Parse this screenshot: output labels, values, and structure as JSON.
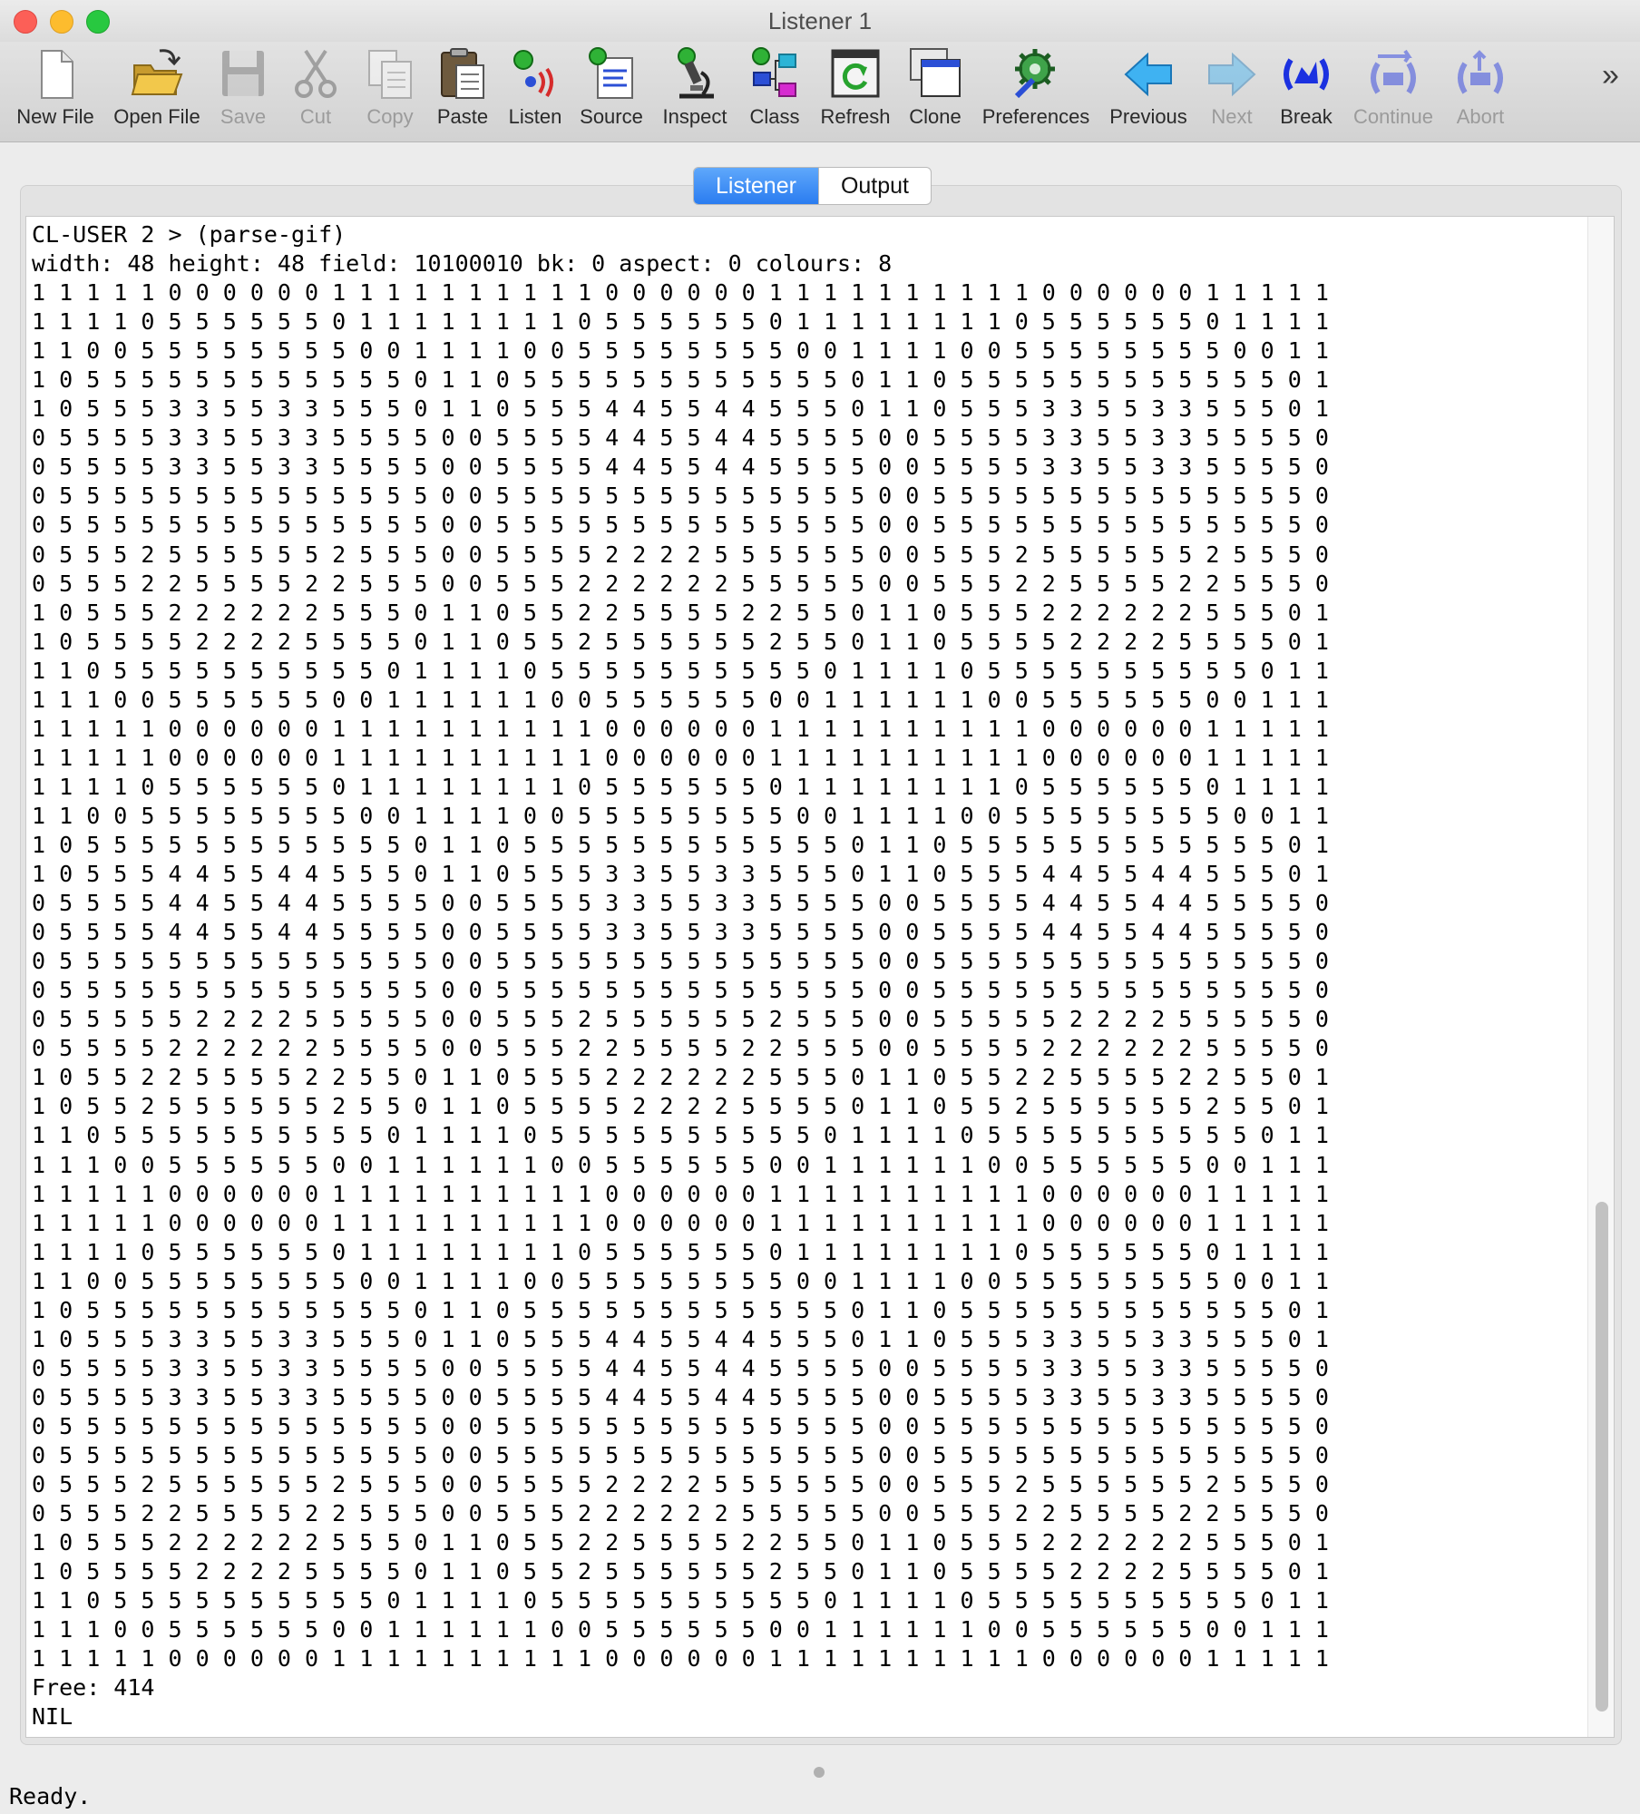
{
  "window": {
    "title": "Listener 1"
  },
  "toolbar": {
    "new_file": "New File",
    "open_file": "Open File",
    "save": "Save",
    "cut": "Cut",
    "copy": "Copy",
    "paste": "Paste",
    "listen": "Listen",
    "source": "Source",
    "inspect": "Inspect",
    "class": "Class",
    "refresh": "Refresh",
    "clone": "Clone",
    "preferences": "Preferences",
    "previous": "Previous",
    "next": "Next",
    "break": "Break",
    "continue": "Continue",
    "abort": "Abort",
    "overflow": "»"
  },
  "tabs": {
    "listener": "Listener",
    "output": "Output",
    "active": "Listener"
  },
  "listener": {
    "prompt": "CL-USER 2 > (parse-gif)",
    "info": "width: 48 height: 48 field: 10100010 bk: 0 aspect: 0 colours: 8",
    "rows": [
      "1 1 1 1 1 0 0 0 0 0 0 1 1 1 1 1 1 1 1 1 1 0 0 0 0 0 0 1 1 1 1 1 1 1 1 1 1 0 0 0 0 0 0 1 1 1 1 1",
      "1 1 1 1 0 5 5 5 5 5 5 0 1 1 1 1 1 1 1 1 0 5 5 5 5 5 5 0 1 1 1 1 1 1 1 1 0 5 5 5 5 5 5 0 1 1 1 1",
      "1 1 0 0 5 5 5 5 5 5 5 5 0 0 1 1 1 1 0 0 5 5 5 5 5 5 5 5 0 0 1 1 1 1 0 0 5 5 5 5 5 5 5 5 0 0 1 1",
      "1 0 5 5 5 5 5 5 5 5 5 5 5 5 0 1 1 0 5 5 5 5 5 5 5 5 5 5 5 5 0 1 1 0 5 5 5 5 5 5 5 5 5 5 5 5 0 1",
      "1 0 5 5 5 3 3 5 5 3 3 5 5 5 0 1 1 0 5 5 5 4 4 5 5 4 4 5 5 5 0 1 1 0 5 5 5 3 3 5 5 3 3 5 5 5 0 1",
      "0 5 5 5 5 3 3 5 5 3 3 5 5 5 5 0 0 5 5 5 5 4 4 5 5 4 4 5 5 5 5 0 0 5 5 5 5 3 3 5 5 3 3 5 5 5 5 0",
      "0 5 5 5 5 3 3 5 5 3 3 5 5 5 5 0 0 5 5 5 5 4 4 5 5 4 4 5 5 5 5 0 0 5 5 5 5 3 3 5 5 3 3 5 5 5 5 0",
      "0 5 5 5 5 5 5 5 5 5 5 5 5 5 5 0 0 5 5 5 5 5 5 5 5 5 5 5 5 5 5 0 0 5 5 5 5 5 5 5 5 5 5 5 5 5 5 0",
      "0 5 5 5 5 5 5 5 5 5 5 5 5 5 5 0 0 5 5 5 5 5 5 5 5 5 5 5 5 5 5 0 0 5 5 5 5 5 5 5 5 5 5 5 5 5 5 0",
      "0 5 5 5 2 5 5 5 5 5 5 2 5 5 5 0 0 5 5 5 5 2 2 2 2 5 5 5 5 5 5 0 0 5 5 5 2 5 5 5 5 5 5 2 5 5 5 0",
      "0 5 5 5 2 2 5 5 5 5 2 2 5 5 5 0 0 5 5 5 2 2 2 2 2 2 5 5 5 5 5 0 0 5 5 5 2 2 5 5 5 5 2 2 5 5 5 0",
      "1 0 5 5 5 2 2 2 2 2 2 5 5 5 0 1 1 0 5 5 2 2 5 5 5 5 2 2 5 5 0 1 1 0 5 5 5 2 2 2 2 2 2 5 5 5 0 1",
      "1 0 5 5 5 5 2 2 2 2 5 5 5 5 0 1 1 0 5 5 2 5 5 5 5 5 5 2 5 5 0 1 1 0 5 5 5 5 2 2 2 2 5 5 5 5 0 1",
      "1 1 0 5 5 5 5 5 5 5 5 5 5 0 1 1 1 1 0 5 5 5 5 5 5 5 5 5 5 0 1 1 1 1 0 5 5 5 5 5 5 5 5 5 5 0 1 1",
      "1 1 1 0 0 5 5 5 5 5 5 0 0 1 1 1 1 1 1 0 0 5 5 5 5 5 5 0 0 1 1 1 1 1 1 0 0 5 5 5 5 5 5 0 0 1 1 1",
      "1 1 1 1 1 0 0 0 0 0 0 1 1 1 1 1 1 1 1 1 1 0 0 0 0 0 0 1 1 1 1 1 1 1 1 1 1 0 0 0 0 0 0 1 1 1 1 1",
      "1 1 1 1 1 0 0 0 0 0 0 1 1 1 1 1 1 1 1 1 1 0 0 0 0 0 0 1 1 1 1 1 1 1 1 1 1 0 0 0 0 0 0 1 1 1 1 1",
      "1 1 1 1 0 5 5 5 5 5 5 0 1 1 1 1 1 1 1 1 0 5 5 5 5 5 5 0 1 1 1 1 1 1 1 1 0 5 5 5 5 5 5 0 1 1 1 1",
      "1 1 0 0 5 5 5 5 5 5 5 5 0 0 1 1 1 1 0 0 5 5 5 5 5 5 5 5 0 0 1 1 1 1 0 0 5 5 5 5 5 5 5 5 0 0 1 1",
      "1 0 5 5 5 5 5 5 5 5 5 5 5 5 0 1 1 0 5 5 5 5 5 5 5 5 5 5 5 5 0 1 1 0 5 5 5 5 5 5 5 5 5 5 5 5 0 1",
      "1 0 5 5 5 4 4 5 5 4 4 5 5 5 0 1 1 0 5 5 5 3 3 5 5 3 3 5 5 5 0 1 1 0 5 5 5 4 4 5 5 4 4 5 5 5 0 1",
      "0 5 5 5 5 4 4 5 5 4 4 5 5 5 5 0 0 5 5 5 5 3 3 5 5 3 3 5 5 5 5 0 0 5 5 5 5 4 4 5 5 4 4 5 5 5 5 0",
      "0 5 5 5 5 4 4 5 5 4 4 5 5 5 5 0 0 5 5 5 5 3 3 5 5 3 3 5 5 5 5 0 0 5 5 5 5 4 4 5 5 4 4 5 5 5 5 0",
      "0 5 5 5 5 5 5 5 5 5 5 5 5 5 5 0 0 5 5 5 5 5 5 5 5 5 5 5 5 5 5 0 0 5 5 5 5 5 5 5 5 5 5 5 5 5 5 0",
      "0 5 5 5 5 5 5 5 5 5 5 5 5 5 5 0 0 5 5 5 5 5 5 5 5 5 5 5 5 5 5 0 0 5 5 5 5 5 5 5 5 5 5 5 5 5 5 0",
      "0 5 5 5 5 5 2 2 2 2 5 5 5 5 5 0 0 5 5 5 2 5 5 5 5 5 5 2 5 5 5 0 0 5 5 5 5 5 2 2 2 2 5 5 5 5 5 0",
      "0 5 5 5 5 2 2 2 2 2 2 5 5 5 5 0 0 5 5 5 2 2 5 5 5 5 2 2 5 5 5 0 0 5 5 5 5 2 2 2 2 2 2 5 5 5 5 0",
      "1 0 5 5 2 2 5 5 5 5 2 2 5 5 0 1 1 0 5 5 5 2 2 2 2 2 2 5 5 5 0 1 1 0 5 5 2 2 5 5 5 5 2 2 5 5 0 1",
      "1 0 5 5 2 5 5 5 5 5 5 2 5 5 0 1 1 0 5 5 5 5 2 2 2 2 5 5 5 5 0 1 1 0 5 5 2 5 5 5 5 5 5 2 5 5 0 1",
      "1 1 0 5 5 5 5 5 5 5 5 5 5 0 1 1 1 1 0 5 5 5 5 5 5 5 5 5 5 0 1 1 1 1 0 5 5 5 5 5 5 5 5 5 5 0 1 1",
      "1 1 1 0 0 5 5 5 5 5 5 0 0 1 1 1 1 1 1 0 0 5 5 5 5 5 5 0 0 1 1 1 1 1 1 0 0 5 5 5 5 5 5 0 0 1 1 1",
      "1 1 1 1 1 0 0 0 0 0 0 1 1 1 1 1 1 1 1 1 1 0 0 0 0 0 0 1 1 1 1 1 1 1 1 1 1 0 0 0 0 0 0 1 1 1 1 1",
      "1 1 1 1 1 0 0 0 0 0 0 1 1 1 1 1 1 1 1 1 1 0 0 0 0 0 0 1 1 1 1 1 1 1 1 1 1 0 0 0 0 0 0 1 1 1 1 1",
      "1 1 1 1 0 5 5 5 5 5 5 0 1 1 1 1 1 1 1 1 0 5 5 5 5 5 5 0 1 1 1 1 1 1 1 1 0 5 5 5 5 5 5 0 1 1 1 1",
      "1 1 0 0 5 5 5 5 5 5 5 5 0 0 1 1 1 1 0 0 5 5 5 5 5 5 5 5 0 0 1 1 1 1 0 0 5 5 5 5 5 5 5 5 0 0 1 1",
      "1 0 5 5 5 5 5 5 5 5 5 5 5 5 0 1 1 0 5 5 5 5 5 5 5 5 5 5 5 5 0 1 1 0 5 5 5 5 5 5 5 5 5 5 5 5 0 1",
      "1 0 5 5 5 3 3 5 5 3 3 5 5 5 0 1 1 0 5 5 5 4 4 5 5 4 4 5 5 5 0 1 1 0 5 5 5 3 3 5 5 3 3 5 5 5 0 1",
      "0 5 5 5 5 3 3 5 5 3 3 5 5 5 5 0 0 5 5 5 5 4 4 5 5 4 4 5 5 5 5 0 0 5 5 5 5 3 3 5 5 3 3 5 5 5 5 0",
      "0 5 5 5 5 3 3 5 5 3 3 5 5 5 5 0 0 5 5 5 5 4 4 5 5 4 4 5 5 5 5 0 0 5 5 5 5 3 3 5 5 3 3 5 5 5 5 0",
      "0 5 5 5 5 5 5 5 5 5 5 5 5 5 5 0 0 5 5 5 5 5 5 5 5 5 5 5 5 5 5 0 0 5 5 5 5 5 5 5 5 5 5 5 5 5 5 0",
      "0 5 5 5 5 5 5 5 5 5 5 5 5 5 5 0 0 5 5 5 5 5 5 5 5 5 5 5 5 5 5 0 0 5 5 5 5 5 5 5 5 5 5 5 5 5 5 0",
      "0 5 5 5 2 5 5 5 5 5 5 2 5 5 5 0 0 5 5 5 5 2 2 2 2 5 5 5 5 5 5 0 0 5 5 5 2 5 5 5 5 5 5 2 5 5 5 0",
      "0 5 5 5 2 2 5 5 5 5 2 2 5 5 5 0 0 5 5 5 2 2 2 2 2 2 5 5 5 5 5 0 0 5 5 5 2 2 5 5 5 5 2 2 5 5 5 0",
      "1 0 5 5 5 2 2 2 2 2 2 5 5 5 0 1 1 0 5 5 2 2 5 5 5 5 2 2 5 5 0 1 1 0 5 5 5 2 2 2 2 2 2 5 5 5 0 1",
      "1 0 5 5 5 5 2 2 2 2 5 5 5 5 0 1 1 0 5 5 2 5 5 5 5 5 5 2 5 5 0 1 1 0 5 5 5 5 2 2 2 2 5 5 5 5 0 1",
      "1 1 0 5 5 5 5 5 5 5 5 5 5 0 1 1 1 1 0 5 5 5 5 5 5 5 5 5 5 0 1 1 1 1 0 5 5 5 5 5 5 5 5 5 5 0 1 1",
      "1 1 1 0 0 5 5 5 5 5 5 0 0 1 1 1 1 1 1 0 0 5 5 5 5 5 5 0 0 1 1 1 1 1 1 0 0 5 5 5 5 5 5 0 0 1 1 1",
      "1 1 1 1 1 0 0 0 0 0 0 1 1 1 1 1 1 1 1 1 1 0 0 0 0 0 0 1 1 1 1 1 1 1 1 1 1 0 0 0 0 0 0 1 1 1 1 1"
    ],
    "free": "Free: 414",
    "result": "NIL"
  },
  "status": {
    "text": "Ready."
  },
  "colors": {
    "accent": "#2a7cf0",
    "close": "#fc5f57",
    "minimize": "#fdbc2e",
    "zoom": "#28c840"
  }
}
